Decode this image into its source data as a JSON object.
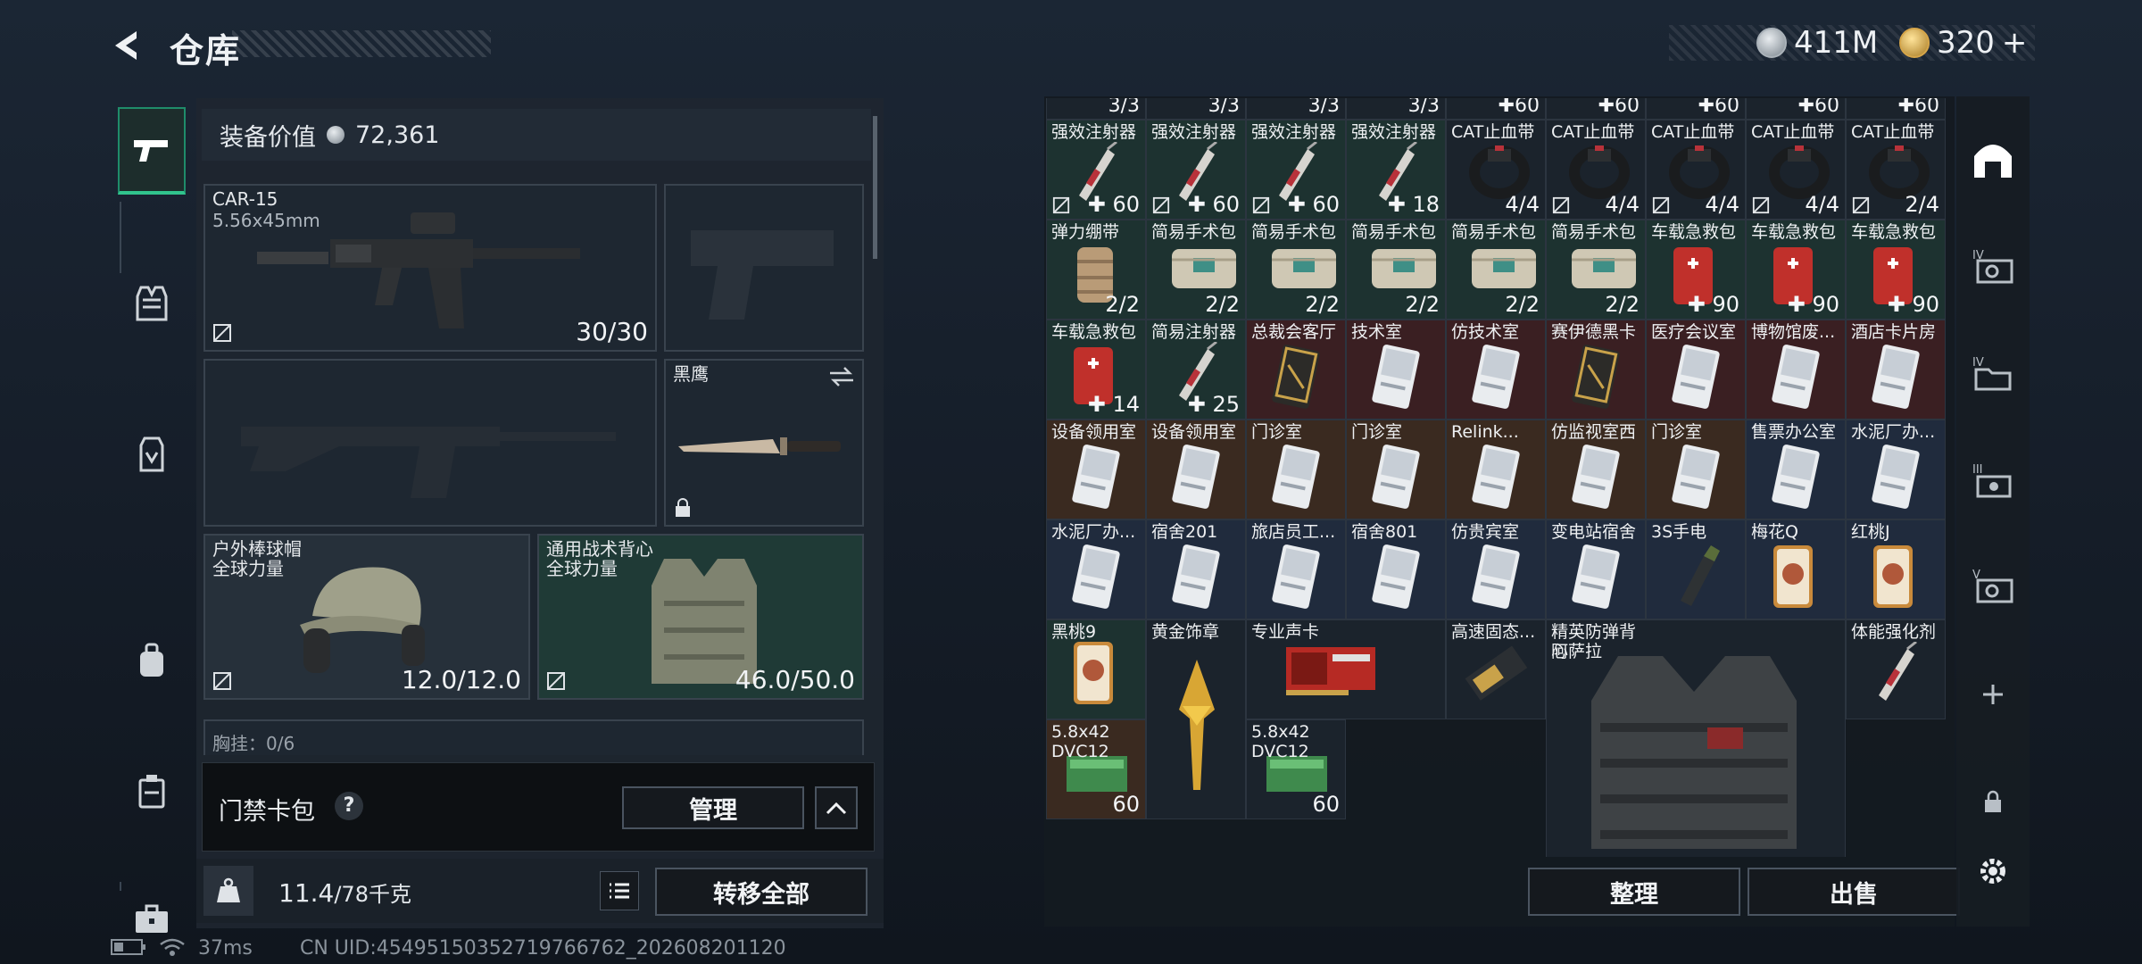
{
  "header": {
    "title": "仓库",
    "currency": [
      {
        "icon": "silver-coin-icon",
        "value": "411M"
      },
      {
        "icon": "gold-coin-icon",
        "value": "320",
        "suffix": "+"
      }
    ]
  },
  "left_nav": [
    "pistol-icon",
    "vest-icon",
    "rig-icon",
    "backpack-icon",
    "case-icon",
    "toolbox-icon"
  ],
  "equipment": {
    "value_label": "装备价值",
    "value": "72,361",
    "primary": {
      "name": "CAR-15",
      "caliber": "5.56x45mm",
      "count": "30/30"
    },
    "melee": {
      "name": "黑鹰"
    },
    "helmet": {
      "name": "户外棒球帽",
      "brand": "全球力量",
      "durability": "12.0/12.0"
    },
    "armor": {
      "name": "通用战术背心",
      "brand": "全球力量",
      "durability": "46.0/50.0"
    },
    "chest_rig_partial": "胸挂：0/6",
    "keycard": {
      "label": "门禁卡包",
      "help": "?",
      "manage": "管理"
    },
    "weight": {
      "value": "11.4",
      "max": "/78千克"
    },
    "transfer_all": "转移全部"
  },
  "storage": {
    "top_row_counts": [
      "3/3",
      "3/3",
      "3/3",
      "3/3",
      "60",
      "60",
      "60",
      "60",
      "60"
    ],
    "rows": [
      [
        {
          "name": "强效注射器",
          "count": "60",
          "plus": true,
          "lock": true,
          "bg": "green",
          "art": "syringe"
        },
        {
          "name": "强效注射器",
          "count": "60",
          "plus": true,
          "lock": true,
          "bg": "green",
          "art": "syringe"
        },
        {
          "name": "强效注射器",
          "count": "60",
          "plus": true,
          "lock": true,
          "bg": "green",
          "art": "syringe"
        },
        {
          "name": "强效注射器",
          "count": "18",
          "plus": true,
          "lock": false,
          "bg": "green",
          "art": "syringe"
        },
        {
          "name": "CAT止血带",
          "count": "4/4",
          "plus": false,
          "lock": false,
          "bg": "dark",
          "art": "tourniquet"
        },
        {
          "name": "CAT止血带",
          "count": "4/4",
          "plus": false,
          "lock": true,
          "bg": "dark",
          "art": "tourniquet"
        },
        {
          "name": "CAT止血带",
          "count": "4/4",
          "plus": false,
          "lock": true,
          "bg": "dark",
          "art": "tourniquet"
        },
        {
          "name": "CAT止血带",
          "count": "4/4",
          "plus": false,
          "lock": true,
          "bg": "dark",
          "art": "tourniquet"
        },
        {
          "name": "CAT止血带",
          "count": "2/4",
          "plus": false,
          "lock": true,
          "bg": "dark",
          "art": "tourniquet"
        }
      ],
      [
        {
          "name": "弹力绷带",
          "count": "2/2",
          "plus": false,
          "lock": false,
          "bg": "green",
          "art": "bandage"
        },
        {
          "name": "简易手术包",
          "count": "2/2",
          "plus": false,
          "lock": false,
          "bg": "green",
          "art": "kit"
        },
        {
          "name": "简易手术包",
          "count": "2/2",
          "plus": false,
          "lock": false,
          "bg": "green",
          "art": "kit"
        },
        {
          "name": "简易手术包",
          "count": "2/2",
          "plus": false,
          "lock": false,
          "bg": "green",
          "art": "kit"
        },
        {
          "name": "简易手术包",
          "count": "2/2",
          "plus": false,
          "lock": false,
          "bg": "green",
          "art": "kit"
        },
        {
          "name": "简易手术包",
          "count": "2/2",
          "plus": false,
          "lock": false,
          "bg": "green",
          "art": "kit"
        },
        {
          "name": "车载急救包",
          "count": "90",
          "plus": true,
          "lock": false,
          "bg": "green",
          "art": "redkit"
        },
        {
          "name": "车载急救包",
          "count": "90",
          "plus": true,
          "lock": false,
          "bg": "green",
          "art": "redkit"
        },
        {
          "name": "车载急救包",
          "count": "90",
          "plus": true,
          "lock": false,
          "bg": "green",
          "art": "redkit"
        }
      ],
      [
        {
          "name": "车载急救包",
          "count": "14",
          "plus": true,
          "lock": false,
          "bg": "green",
          "art": "redkit"
        },
        {
          "name": "简易注射器",
          "count": "25",
          "plus": true,
          "lock": false,
          "bg": "green",
          "art": "syringe"
        },
        {
          "name": "总裁会客厅",
          "count": "",
          "plus": false,
          "lock": false,
          "bg": "red",
          "art": "goldcard"
        },
        {
          "name": "技术室",
          "count": "",
          "plus": false,
          "lock": false,
          "bg": "red",
          "art": "card"
        },
        {
          "name": "仿技术室",
          "count": "",
          "plus": false,
          "lock": false,
          "bg": "red",
          "art": "card"
        },
        {
          "name": "赛伊德黑卡",
          "count": "",
          "plus": false,
          "lock": false,
          "bg": "red",
          "art": "goldcard"
        },
        {
          "name": "医疗会议室",
          "count": "",
          "plus": false,
          "lock": false,
          "bg": "red",
          "art": "card"
        },
        {
          "name": "博物馆废...",
          "count": "",
          "plus": false,
          "lock": false,
          "bg": "red",
          "art": "card"
        },
        {
          "name": "酒店卡片房",
          "count": "",
          "plus": false,
          "lock": false,
          "bg": "red",
          "art": "card"
        }
      ],
      [
        {
          "name": "设备领用室",
          "count": "",
          "plus": false,
          "lock": false,
          "bg": "orange",
          "art": "card"
        },
        {
          "name": "设备领用室",
          "count": "",
          "plus": false,
          "lock": false,
          "bg": "orange",
          "art": "card"
        },
        {
          "name": "门诊室",
          "count": "",
          "plus": false,
          "lock": false,
          "bg": "orange",
          "art": "card"
        },
        {
          "name": "门诊室",
          "count": "",
          "plus": false,
          "lock": false,
          "bg": "orange",
          "art": "card"
        },
        {
          "name": "Relink...",
          "count": "",
          "plus": false,
          "lock": false,
          "bg": "orange",
          "art": "card"
        },
        {
          "name": "仿监视室西",
          "count": "",
          "plus": false,
          "lock": false,
          "bg": "orange",
          "art": "card"
        },
        {
          "name": "门诊室",
          "count": "",
          "plus": false,
          "lock": false,
          "bg": "orange",
          "art": "card"
        },
        {
          "name": "售票办公室",
          "count": "",
          "plus": false,
          "lock": false,
          "bg": "blue",
          "art": "card"
        },
        {
          "name": "水泥厂办...",
          "count": "",
          "plus": false,
          "lock": false,
          "bg": "blue",
          "art": "card"
        }
      ],
      [
        {
          "name": "水泥厂办...",
          "count": "",
          "plus": false,
          "lock": false,
          "bg": "blue",
          "art": "card"
        },
        {
          "name": "宿舍201",
          "count": "",
          "plus": false,
          "lock": false,
          "bg": "blue",
          "art": "card"
        },
        {
          "name": "旅店员工...",
          "count": "",
          "plus": false,
          "lock": false,
          "bg": "blue",
          "art": "card"
        },
        {
          "name": "宿舍801",
          "count": "",
          "plus": false,
          "lock": false,
          "bg": "blue",
          "art": "card"
        },
        {
          "name": "仿贵宾室",
          "count": "",
          "plus": false,
          "lock": false,
          "bg": "blue",
          "art": "card"
        },
        {
          "name": "变电站宿舍",
          "count": "",
          "plus": false,
          "lock": false,
          "bg": "blue",
          "art": "card"
        },
        {
          "name": "3S手电",
          "count": "",
          "plus": false,
          "lock": false,
          "bg": "blue",
          "art": "flashlight"
        },
        {
          "name": "梅花Q",
          "count": "",
          "plus": false,
          "lock": false,
          "bg": "blue",
          "art": "playcard"
        },
        {
          "name": "红桃J",
          "count": "",
          "plus": false,
          "lock": false,
          "bg": "blue",
          "art": "playcard"
        }
      ]
    ],
    "bottom_items": [
      {
        "name": "黑桃9",
        "art": "playcard"
      },
      {
        "name": "黄金饰章",
        "art": "badge"
      },
      {
        "name": "专业声卡",
        "art": "gpu"
      },
      {
        "name": "高速固态...",
        "art": "ssd"
      },
      {
        "name": "精英防弹背心",
        "brand": "阿萨拉",
        "art": "vest"
      },
      {
        "name": "体能强化剂",
        "art": "syringe"
      },
      {
        "name": "5.8x42 DVC12",
        "count": "60",
        "art": "ammo"
      },
      {
        "name": "5.8x42 DVC12",
        "count": "60",
        "art": "ammo"
      }
    ],
    "sort_button": "整理",
    "sell_button": "出售"
  },
  "right_nav": [
    "base-icon",
    "container-iv-icon",
    "container-iv-folder-icon",
    "container-iii-icon",
    "container-v-icon",
    "add-icon",
    "lock-icon",
    "settings-icon"
  ],
  "status": {
    "ping": "37ms",
    "uid": "CN UID:4549515035271976676​2_202608201120"
  },
  "colors": {
    "accent": "#31c48d",
    "active_bg": "#1d2d2c"
  }
}
